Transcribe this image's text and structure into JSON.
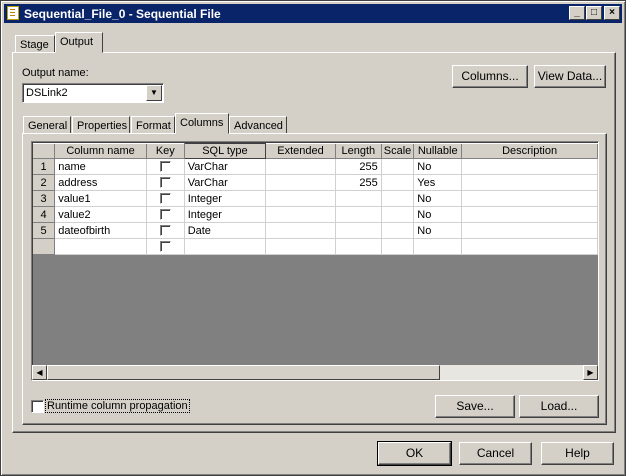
{
  "window": {
    "title": "Sequential_File_0 - Sequential File",
    "min_glyph": "_",
    "max_glyph": "□",
    "close_glyph": "×"
  },
  "top_tabs": [
    {
      "label": "Stage",
      "active": false
    },
    {
      "label": "Output",
      "active": true
    }
  ],
  "output": {
    "name_label": "Output name:",
    "name_value": "DSLink2",
    "columns_button": "Columns...",
    "view_data_button": "View Data..."
  },
  "sub_tabs": [
    {
      "label": "General",
      "active": false
    },
    {
      "label": "Properties",
      "active": false
    },
    {
      "label": "Format",
      "active": false
    },
    {
      "label": "Columns",
      "active": true
    },
    {
      "label": "Advanced",
      "active": false
    }
  ],
  "grid": {
    "headers": [
      "Column name",
      "Key",
      "SQL type",
      "Extended",
      "Length",
      "Scale",
      "Nullable",
      "Description"
    ],
    "rows": [
      {
        "num": "1",
        "name": "name",
        "key": false,
        "sql_type": "VarChar",
        "extended": "",
        "length": "255",
        "scale": "",
        "nullable": "No",
        "description": ""
      },
      {
        "num": "2",
        "name": "address",
        "key": false,
        "sql_type": "VarChar",
        "extended": "",
        "length": "255",
        "scale": "",
        "nullable": "Yes",
        "description": ""
      },
      {
        "num": "3",
        "name": "value1",
        "key": false,
        "sql_type": "Integer",
        "extended": "",
        "length": "",
        "scale": "",
        "nullable": "No",
        "description": ""
      },
      {
        "num": "4",
        "name": "value2",
        "key": false,
        "sql_type": "Integer",
        "extended": "",
        "length": "",
        "scale": "",
        "nullable": "No",
        "description": ""
      },
      {
        "num": "5",
        "name": "dateofbirth",
        "key": false,
        "sql_type": "Date",
        "extended": "",
        "length": "",
        "scale": "",
        "nullable": "No",
        "description": ""
      }
    ]
  },
  "footer": {
    "rcp_label": "Runtime column propagation",
    "save_button": "Save...",
    "load_button": "Load..."
  },
  "dialog_buttons": {
    "ok": "OK",
    "cancel": "Cancel",
    "help": "Help"
  },
  "icons": {
    "scroll_left": "◀",
    "scroll_right": "▶",
    "dropdown": "▼"
  },
  "colors": {
    "titlebar": "#0a246a",
    "face": "#d4d0c8",
    "grid_empty": "#808080"
  }
}
